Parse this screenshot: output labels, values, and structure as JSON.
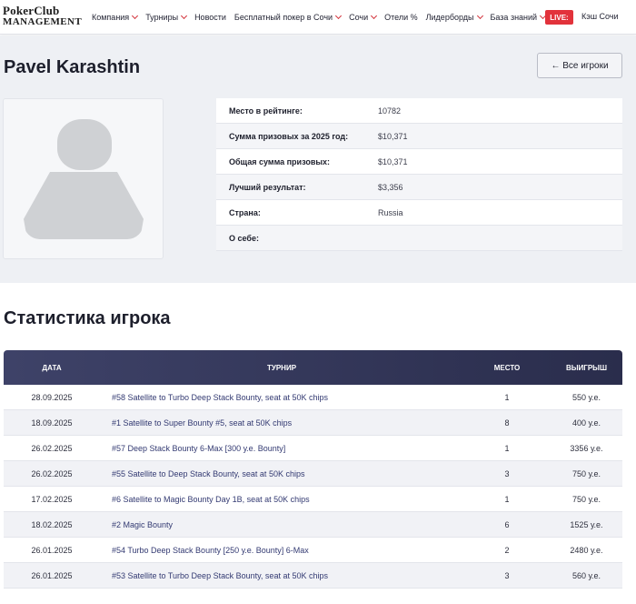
{
  "header": {
    "logo_line1": "PokerClub",
    "logo_line2": "MANAGEMENT",
    "nav": [
      {
        "label": "Компания",
        "dropdown": true
      },
      {
        "label": "Турниры",
        "dropdown": true
      },
      {
        "label": "Новости",
        "dropdown": false
      },
      {
        "label": "Бесплатный покер в Сочи",
        "dropdown": true
      },
      {
        "label": "Сочи",
        "dropdown": true
      },
      {
        "label": "Отели %",
        "dropdown": false
      },
      {
        "label": "Лидерборды",
        "dropdown": true
      },
      {
        "label": "База знаний",
        "dropdown": true
      }
    ],
    "live_label": "LIVE:",
    "cash_label": "Кэш Сочи",
    "accent_color": "#e2323b"
  },
  "profile": {
    "name": "Pavel Karashtin",
    "back_button": "← Все игроки",
    "info": [
      {
        "label": "Место в рейтинге:",
        "value": "10782"
      },
      {
        "label": "Сумма призовых за 2025 год:",
        "value": "$10,371"
      },
      {
        "label": "Общая сумма призовых:",
        "value": "$10,371"
      },
      {
        "label": "Лучший результат:",
        "value": "$3,356"
      },
      {
        "label": "Страна:",
        "value": "Russia"
      },
      {
        "label": "О себе:",
        "value": ""
      }
    ]
  },
  "stats": {
    "title": "Статистика игрока",
    "columns": {
      "date": "ДАТА",
      "tournament": "ТУРНИР",
      "place": "МЕСТО",
      "winnings": "ВЫИГРЫШ"
    },
    "rows": [
      {
        "date": "28.09.2025",
        "tournament": "#58 Satellite to Turbo Deep Stack Bounty, seat at 50K chips",
        "place": "1",
        "winnings": "550 у.е."
      },
      {
        "date": "18.09.2025",
        "tournament": "#1 Satellite to Super Bounty #5, seat at 50K chips",
        "place": "8",
        "winnings": "400 у.е."
      },
      {
        "date": "26.02.2025",
        "tournament": "#57 Deep Stack Bounty 6-Max [300 у.е. Bounty]",
        "place": "1",
        "winnings": "3356 у.е."
      },
      {
        "date": "26.02.2025",
        "tournament": "#55 Satellite to Deep Stack Bounty, seat at 50K chips",
        "place": "3",
        "winnings": "750 у.е."
      },
      {
        "date": "17.02.2025",
        "tournament": "#6 Satellite to Magic Bounty Day 1B, seat at 50K chips",
        "place": "1",
        "winnings": "750 у.е."
      },
      {
        "date": "18.02.2025",
        "tournament": "#2 Magic Bounty",
        "place": "6",
        "winnings": "1525 у.е."
      },
      {
        "date": "26.01.2025",
        "tournament": "#54 Turbo Deep Stack Bounty [250 у.е. Bounty] 6-Max",
        "place": "2",
        "winnings": "2480 у.е."
      },
      {
        "date": "26.01.2025",
        "tournament": "#53 Satellite to Turbo Deep Stack Bounty, seat at 50K chips",
        "place": "3",
        "winnings": "560 у.е."
      }
    ]
  }
}
